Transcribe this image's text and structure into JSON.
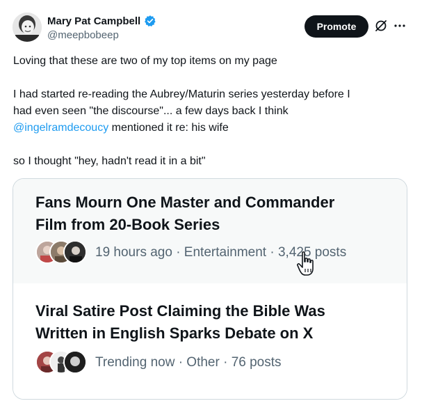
{
  "author": {
    "display_name": "Mary Pat Campbell",
    "handle": "@meepbobeep",
    "verified": true
  },
  "actions": {
    "promote_label": "Promote",
    "grok_icon": "grok-icon",
    "more_icon": "more-icon"
  },
  "post": {
    "line1": "Loving that these are two of my top items on my page",
    "para2_line1": "I had started re-reading the Aubrey/Maturin series yesterday before I",
    "para2_line2": "had even seen \"the discourse\"... a few days back I think",
    "mention": "@ingelramdecoucy",
    "para2_line3_rest": " mentioned it re: his wife",
    "line_last": "so I thought \"hey, hadn't read it in a bit\""
  },
  "trends": [
    {
      "title_line1": "Fans Mourn One Master and Commander",
      "title_line2": "Film from 20-Book Series",
      "meta": "19 hours ago · Entertainment · 3,425 posts"
    },
    {
      "title_line1": "Viral Satire Post Claiming the Bible Was",
      "title_line2": "Written in English Sparks Debate on X",
      "meta": "Trending now · Other · 76 posts"
    }
  ],
  "colors": {
    "text": "#0f1419",
    "secondary": "#536471",
    "link": "#1d9bf0",
    "border": "#cfd9de",
    "hover_bg": "#f7f9f9"
  }
}
